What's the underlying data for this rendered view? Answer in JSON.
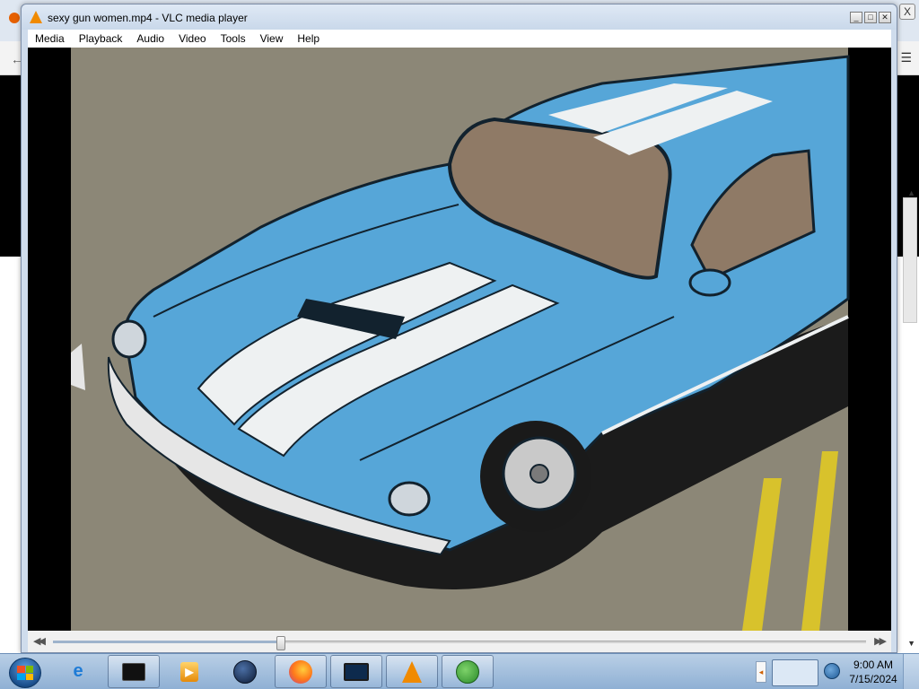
{
  "background_browser": {
    "close_label": "X",
    "back_label": "←",
    "menu_label": "☰"
  },
  "vlc": {
    "title": "sexy gun women.mp4 - VLC media player",
    "menu": [
      "Media",
      "Playback",
      "Audio",
      "Video",
      "Tools",
      "View",
      "Help"
    ],
    "window_buttons": {
      "minimize": "_",
      "maximize": "□",
      "close": "✕"
    },
    "seek": {
      "position_fraction": 0.28,
      "back_label": "◀◀",
      "forward_label": "▶▶"
    }
  },
  "taskbar": {
    "apps": [
      {
        "name": "internet-explorer-icon"
      },
      {
        "name": "terminal-window-icon"
      },
      {
        "name": "media-player-icon"
      },
      {
        "name": "globe-app-icon"
      },
      {
        "name": "firefox-icon"
      },
      {
        "name": "remote-desktop-icon"
      },
      {
        "name": "vlc-icon"
      },
      {
        "name": "download-manager-icon"
      }
    ],
    "clock": {
      "time": "9:00 AM",
      "date": "7/15/2024"
    }
  },
  "colors": {
    "car_blue": "#56a6d8",
    "car_stripe": "#eef1f2",
    "asphalt": "#8c8777",
    "road_line": "#d8c22c",
    "vlc_orange": "#f08a00"
  }
}
